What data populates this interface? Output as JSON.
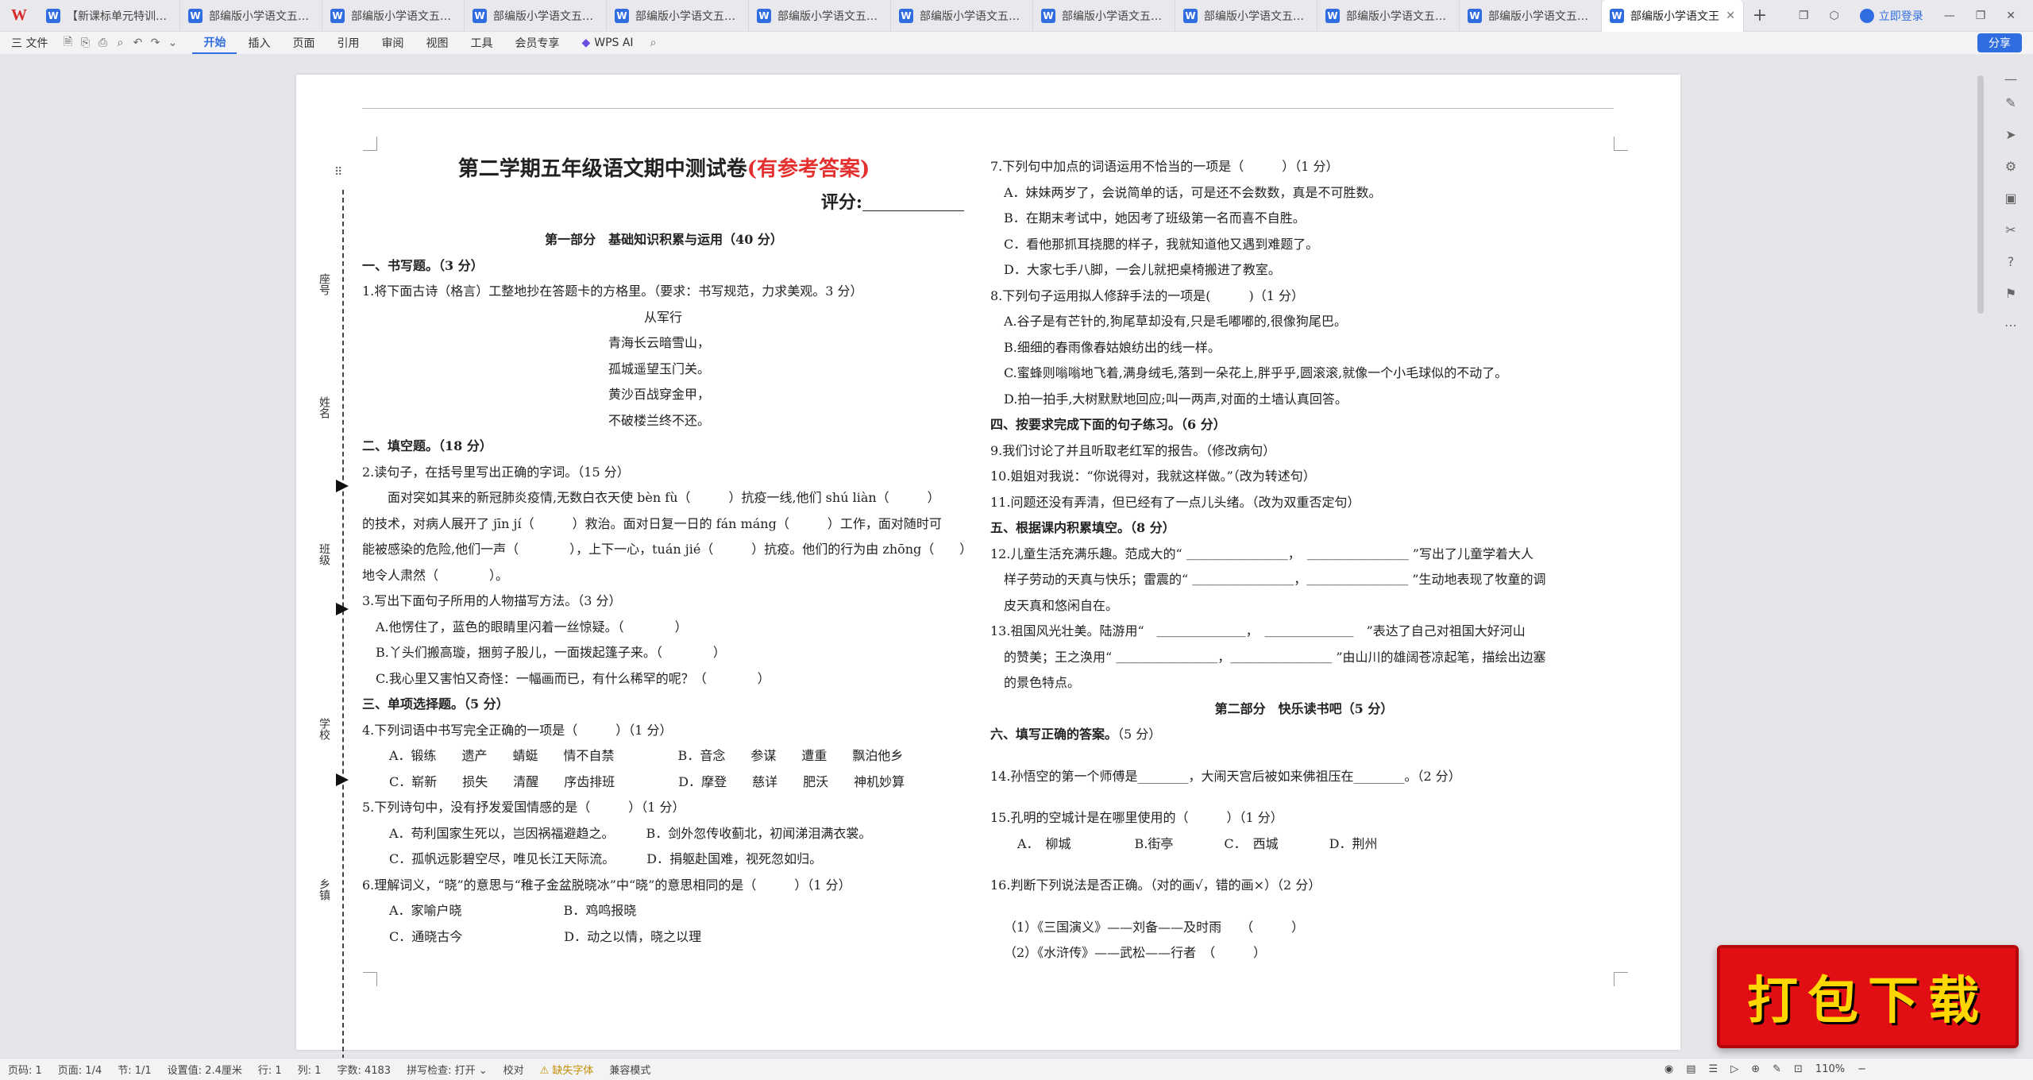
{
  "tabs": {
    "logo": "W",
    "first": "【新课标单元特训】部编",
    "doc": "部编版小学语文五年级下",
    "active": "部编版小学语文王",
    "login": "立即登录"
  },
  "menu": {
    "file": "三 文件",
    "items": [
      "开始",
      "插入",
      "页面",
      "引用",
      "审阅",
      "视图",
      "工具",
      "会员专享"
    ],
    "wpsai": "WPS AI",
    "share": "分享"
  },
  "doc": {
    "title": "第二学期五年级语文期中测试卷",
    "title_red": "(有参考答案)",
    "score_label": "评分:",
    "side": {
      "l1": "座号",
      "l2": "姓名",
      "l3": "班级",
      "l4": "学校",
      "l5": "乡镇"
    },
    "part1": "第一部分　基础知识积累与运用（40 分）",
    "s1": "一、书写题。（3 分）",
    "q1": "1.将下面古诗（格言）工整地抄在答题卡的方格里。（要求：书写规范，力求美观。3 分）",
    "poem": [
      "从军行",
      "青海长云暗雪山，",
      "孤城遥望玉门关。",
      "黄沙百战穿金甲，",
      "不破楼兰终不还。"
    ],
    "s2": "二、填空题。（18 分）",
    "q2": "2.读句子，在括号里写出正确的字词。（15 分）",
    "q2p": [
      "　　面对突如其来的新冠肺炎疫情,无数白衣天使 bèn fù（　　　）抗疫一线,他们 shú liàn（　　　）",
      "的技术，对病人展开了 jīn jí（　　　）救治。面对日复一日的 fán máng（　　　）工作，面对随时可",
      "能被感染的危险,他们一声（　　　　），上下一心，tuán jié（　　　）抗疫。他们的行为由 zhōng（　　）",
      "地令人肃然（　　　　）。"
    ],
    "q3": "3.写出下面句子所用的人物描写方法。（3 分）",
    "q3opts": [
      "A.他愣住了，蓝色的眼睛里闪着一丝惊疑。（　　　　）",
      "B.丫头们搬高璇，捆剪子股儿，一面拨起篷子来。（　　　　）",
      "C.我心里又害怕又奇怪：一幅画而已，有什么稀罕的呢？（　　　　）"
    ],
    "s3": "三、单项选择题。（5 分）",
    "q4": "4.下列词语中书写完全正确的一项是（　　　）（1 分）",
    "q4opts": [
      "A．锻练　　遗产　　蜻蜓　　情不自禁　　　　　B．音念　　参谋　　遭重　　飘泊他乡",
      "C．崭新　　损失　　清醒　　序齿排班　　　　　D．摩登　　慈详　　肥沃　　神机妙算"
    ],
    "q5": "5.下列诗句中，没有抒发爱国情感的是（　　　）（1 分）",
    "q5opts": [
      "A．苟利国家生死以，岂因祸福避趋之。　　　B．剑外忽传收蓟北，初闻涕泪满衣裳。",
      "C．孤帆远影碧空尽，唯见长江天际流。　　　D．捐躯赴国难，视死忽如归。"
    ],
    "q6": "6.理解词义，“晓”的意思与“稚子金盆脱晓冰”中“晓”的意思相同的是（　　　）（1 分）",
    "q6opts": [
      "A．家喻户晓　　　　　　　　B．鸡鸣报晓",
      "C．通晓古今　　　　　　　　D．动之以情，晓之以理"
    ],
    "q7": "7.下列句中加点的词语运用不恰当的一项是（　　　）（1 分）",
    "q7opts": [
      "A．妹妹两岁了，会说简单的话，可是还不会数数，真是不可胜数。",
      "B．在期末考试中，她因考了班级第一名而喜不自胜。",
      "C．看他那抓耳挠腮的样子，我就知道他又遇到难题了。",
      "D．大家七手八脚，一会儿就把桌椅搬进了教室。"
    ],
    "q8": "8.下列句子运用拟人修辞手法的一项是(　　　)（1 分）",
    "q8opts": [
      "A.谷子是有芒针的,狗尾草却没有,只是毛嘟嘟的,很像狗尾巴。",
      "B.细细的春雨像春姑娘纺出的线一样。",
      "C.蜜蜂则嗡嗡地飞着,满身绒毛,落到一朵花上,胖乎乎,圆滚滚,就像一个小毛球似的不动了。",
      "D.拍一拍手,大树默默地回应;叫一两声,对面的土墙认真回答。"
    ],
    "s4": "四、按要求完成下面的句子练习。（6 分）",
    "q9": "9.我们讨论了并且听取老红军的报告。（修改病句）",
    "q10": "10.姐姐对我说：“你说得对，我就这样做。”（改为转述句）",
    "q11": "11.问题还没有弄清，但已经有了一点儿头绪。（改为双重否定句）",
    "s5": "五、根据课内积累填空。（8 分）",
    "q12": [
      "12.儿童生活充满乐趣。范成大的“ ＿＿＿＿＿＿＿＿，　＿＿＿＿＿＿＿＿ ”写出了儿童学着大人",
      "样子劳动的天真与快乐；雷震的“ ＿＿＿＿＿＿＿＿，＿＿＿＿＿＿＿＿ ”生动地表现了牧童的调",
      "皮天真和悠闲自在。"
    ],
    "q13": [
      "13.祖国风光壮美。陆游用“　＿＿＿＿＿＿＿，　＿＿＿＿＿＿＿　”表达了自己对祖国大好河山",
      "的赞美；王之涣用“ ＿＿＿＿＿＿＿＿，＿＿＿＿＿＿＿＿ ”由山川的雄阔苍凉起笔，描绘出边塞",
      "的景色特点。"
    ],
    "part2": "第二部分　快乐读书吧（5 分）",
    "s6": "六、填写正确的答案。",
    "s6score": "（5 分）",
    "q14": "14.孙悟空的第一个师傅是________，大闹天宫后被如来佛祖压在________。（2 分）",
    "q15": "15.孔明的空城计是在哪里使用的（　　　）（1 分）",
    "q15opts": "A．　柳城　　　　　B.街亭　　　　C．　西城　　　　D．荆州",
    "q16": "16.判断下列说法是否正确。（对的画√，错的画×）（2 分）",
    "q16opts": [
      "（1）《三国演义》——刘备——及时雨　　（　　　）",
      "（2）《水浒传》——武松——行者　（　　　）"
    ]
  },
  "status": {
    "page": "页码: 1",
    "pages": "页面: 1/4",
    "section": "节: 1/1",
    "setting": "设置值: 2.4厘米",
    "row": "行: 1",
    "col": "列: 1",
    "words": "字数: 4183",
    "spell": "拼写检查: 打开 ⌄",
    "proof": "校对",
    "font": "⚠ 缺失字体",
    "compat": "兼容模式",
    "zoom": "110%"
  },
  "banner": "打包下载"
}
